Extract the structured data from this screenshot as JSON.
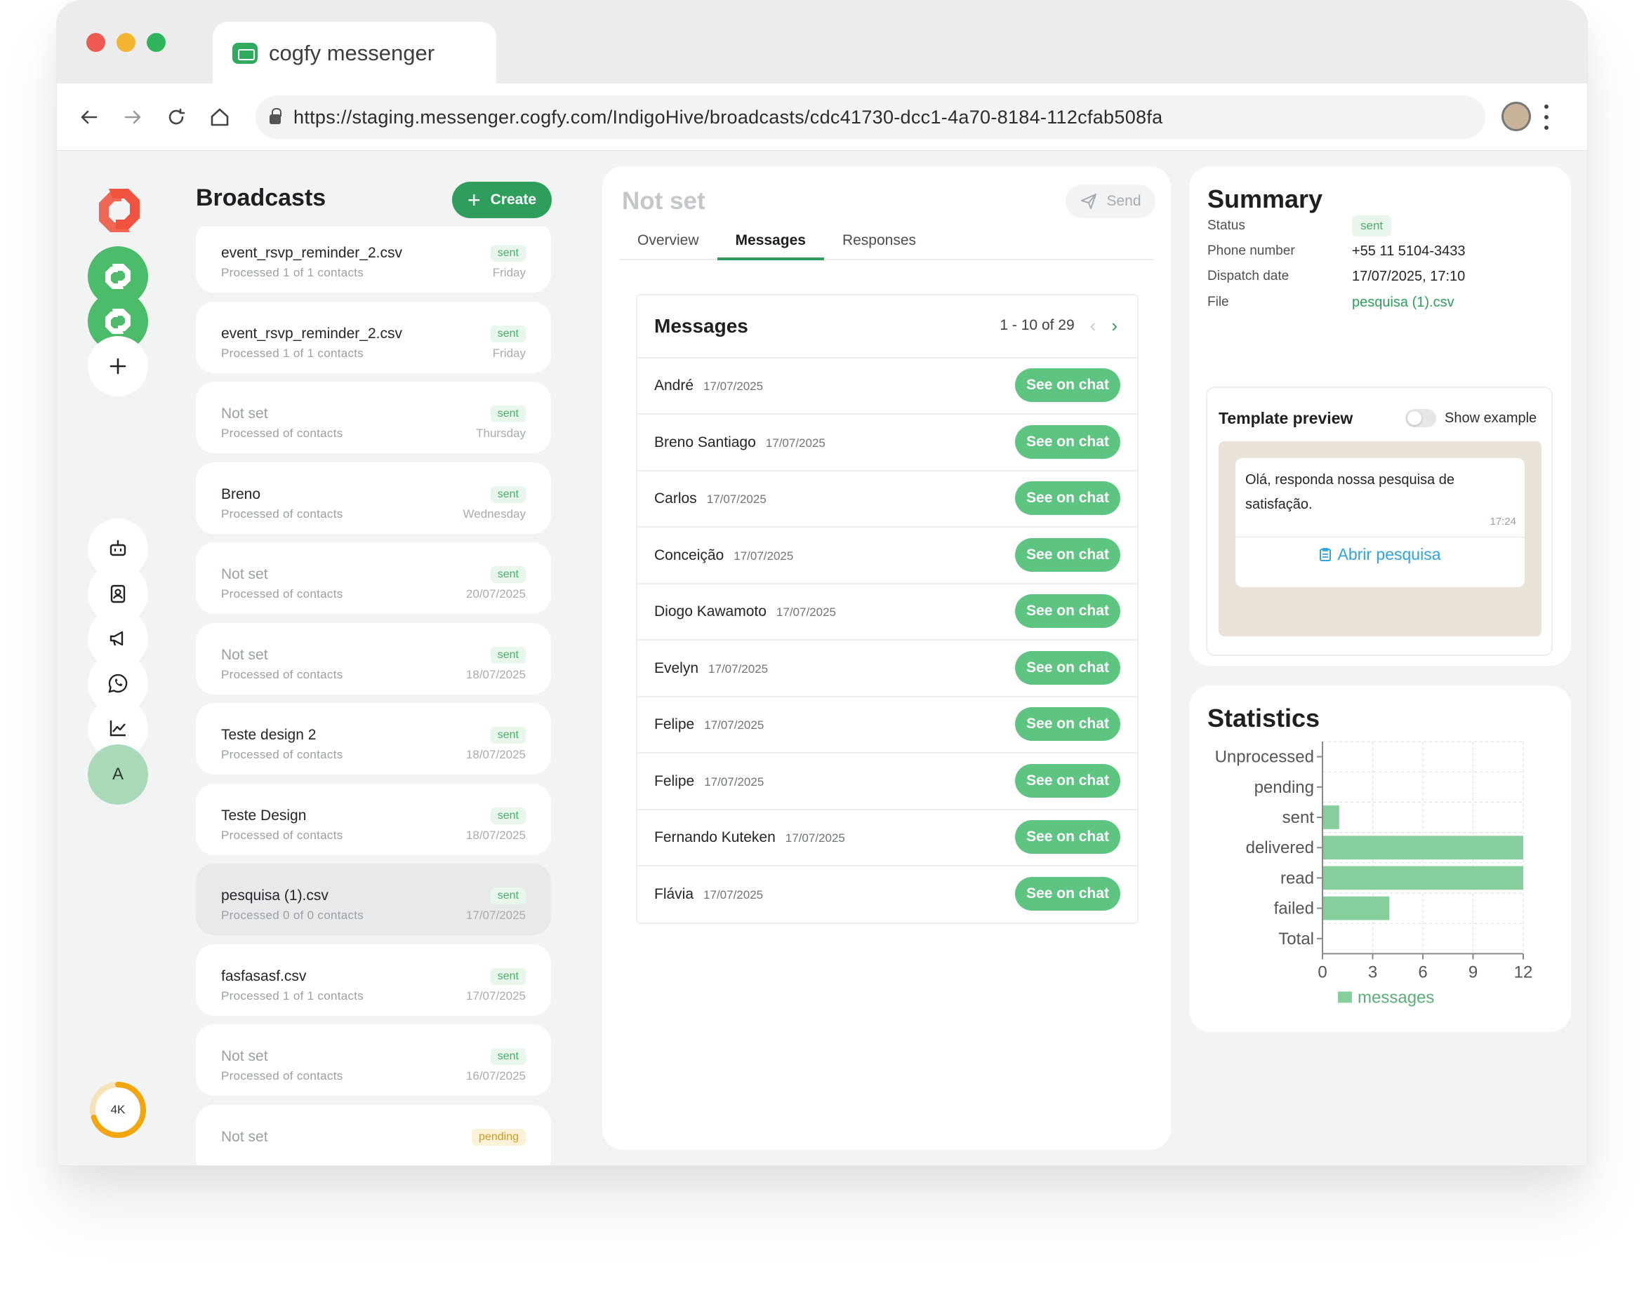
{
  "browser": {
    "tab_title": "cogfy messenger",
    "url": "https://staging.messenger.cogfy.com/IndigoHive/broadcasts/cdc41730-dcc1-4a70-8184-112cfab508fa"
  },
  "rail": {
    "avatar_initial": "A",
    "credits_label": "4K",
    "credits_fraction": 0.7
  },
  "broadcasts": {
    "title": "Broadcasts",
    "create_label": "Create",
    "items": [
      {
        "name": "event_rsvp_reminder_2.csv",
        "sub": "Processed 1 of 1 contacts",
        "status": "sent",
        "date": "Friday",
        "muted": false
      },
      {
        "name": "event_rsvp_reminder_2.csv",
        "sub": "Processed 1 of 1 contacts",
        "status": "sent",
        "date": "Friday",
        "muted": false
      },
      {
        "name": "Not set",
        "sub": "Processed of contacts",
        "status": "sent",
        "date": "Thursday",
        "muted": true
      },
      {
        "name": "Breno",
        "sub": "Processed of contacts",
        "status": "sent",
        "date": "Wednesday",
        "muted": false
      },
      {
        "name": "Not set",
        "sub": "Processed of contacts",
        "status": "sent",
        "date": "20/07/2025",
        "muted": true
      },
      {
        "name": "Not set",
        "sub": "Processed of contacts",
        "status": "sent",
        "date": "18/07/2025",
        "muted": true
      },
      {
        "name": "Teste design 2",
        "sub": "Processed of contacts",
        "status": "sent",
        "date": "18/07/2025",
        "muted": false
      },
      {
        "name": "Teste Design",
        "sub": "Processed of contacts",
        "status": "sent",
        "date": "18/07/2025",
        "muted": false
      },
      {
        "name": "pesquisa (1).csv",
        "sub": "Processed 0 of 0 contacts",
        "status": "sent",
        "date": "17/07/2025",
        "muted": false,
        "selected": true
      },
      {
        "name": "fasfasasf.csv",
        "sub": "Processed 1 of 1 contacts",
        "status": "sent",
        "date": "17/07/2025",
        "muted": false
      },
      {
        "name": "Not set",
        "sub": "Processed of contacts",
        "status": "sent",
        "date": "16/07/2025",
        "muted": true
      },
      {
        "name": "Not set",
        "sub": "",
        "status": "pending",
        "date": "",
        "muted": true
      }
    ]
  },
  "detail": {
    "title": "Not set",
    "send_label": "Send",
    "tabs": [
      "Overview",
      "Messages",
      "Responses"
    ],
    "active_tab": "Messages",
    "messages": {
      "title": "Messages",
      "pagination": "1 - 10 of 29",
      "see_label": "See on chat",
      "rows": [
        {
          "name": "André",
          "date": "17/07/2025"
        },
        {
          "name": "Breno Santiago",
          "date": "17/07/2025"
        },
        {
          "name": "Carlos",
          "date": "17/07/2025"
        },
        {
          "name": "Conceição",
          "date": "17/07/2025"
        },
        {
          "name": "Diogo Kawamoto",
          "date": "17/07/2025"
        },
        {
          "name": "Evelyn",
          "date": "17/07/2025"
        },
        {
          "name": "Felipe",
          "date": "17/07/2025"
        },
        {
          "name": "Felipe",
          "date": "17/07/2025"
        },
        {
          "name": "Fernando Kuteken",
          "date": "17/07/2025"
        },
        {
          "name": "Flávia",
          "date": "17/07/2025"
        }
      ]
    }
  },
  "summary": {
    "title": "Summary",
    "status_label": "Status",
    "status_value": "sent",
    "phone_label": "Phone number",
    "phone_value": "+55 11 5104-3433",
    "dispatch_label": "Dispatch date",
    "dispatch_value": "17/07/2025, 17:10",
    "file_label": "File",
    "file_value": "pesquisa (1).csv",
    "template": {
      "title": "Template preview",
      "toggle_label": "Show example",
      "toggle_on": false,
      "message": "Olá, responda nossa pesquisa de satisfação.",
      "time": "17:24",
      "button_label": "Abrir pesquisa"
    }
  },
  "statistics": {
    "title": "Statistics"
  },
  "colors": {
    "brand_green": "#2f9e5c",
    "button_green": "#5dc481",
    "bar_green": "#86cf9c",
    "logo_red": "#f0533f"
  },
  "chart_data": {
    "type": "bar",
    "orientation": "horizontal",
    "categories": [
      "Unprocessed",
      "pending",
      "sent",
      "delivered",
      "read",
      "failed",
      "Total"
    ],
    "series": [
      {
        "name": "messages",
        "values": [
          0,
          0,
          1,
          12,
          12,
          4,
          0
        ]
      }
    ],
    "xlim": [
      0,
      12
    ],
    "xticks": [
      0,
      3,
      6,
      9,
      12
    ],
    "grid": true,
    "legend": "bottom"
  }
}
